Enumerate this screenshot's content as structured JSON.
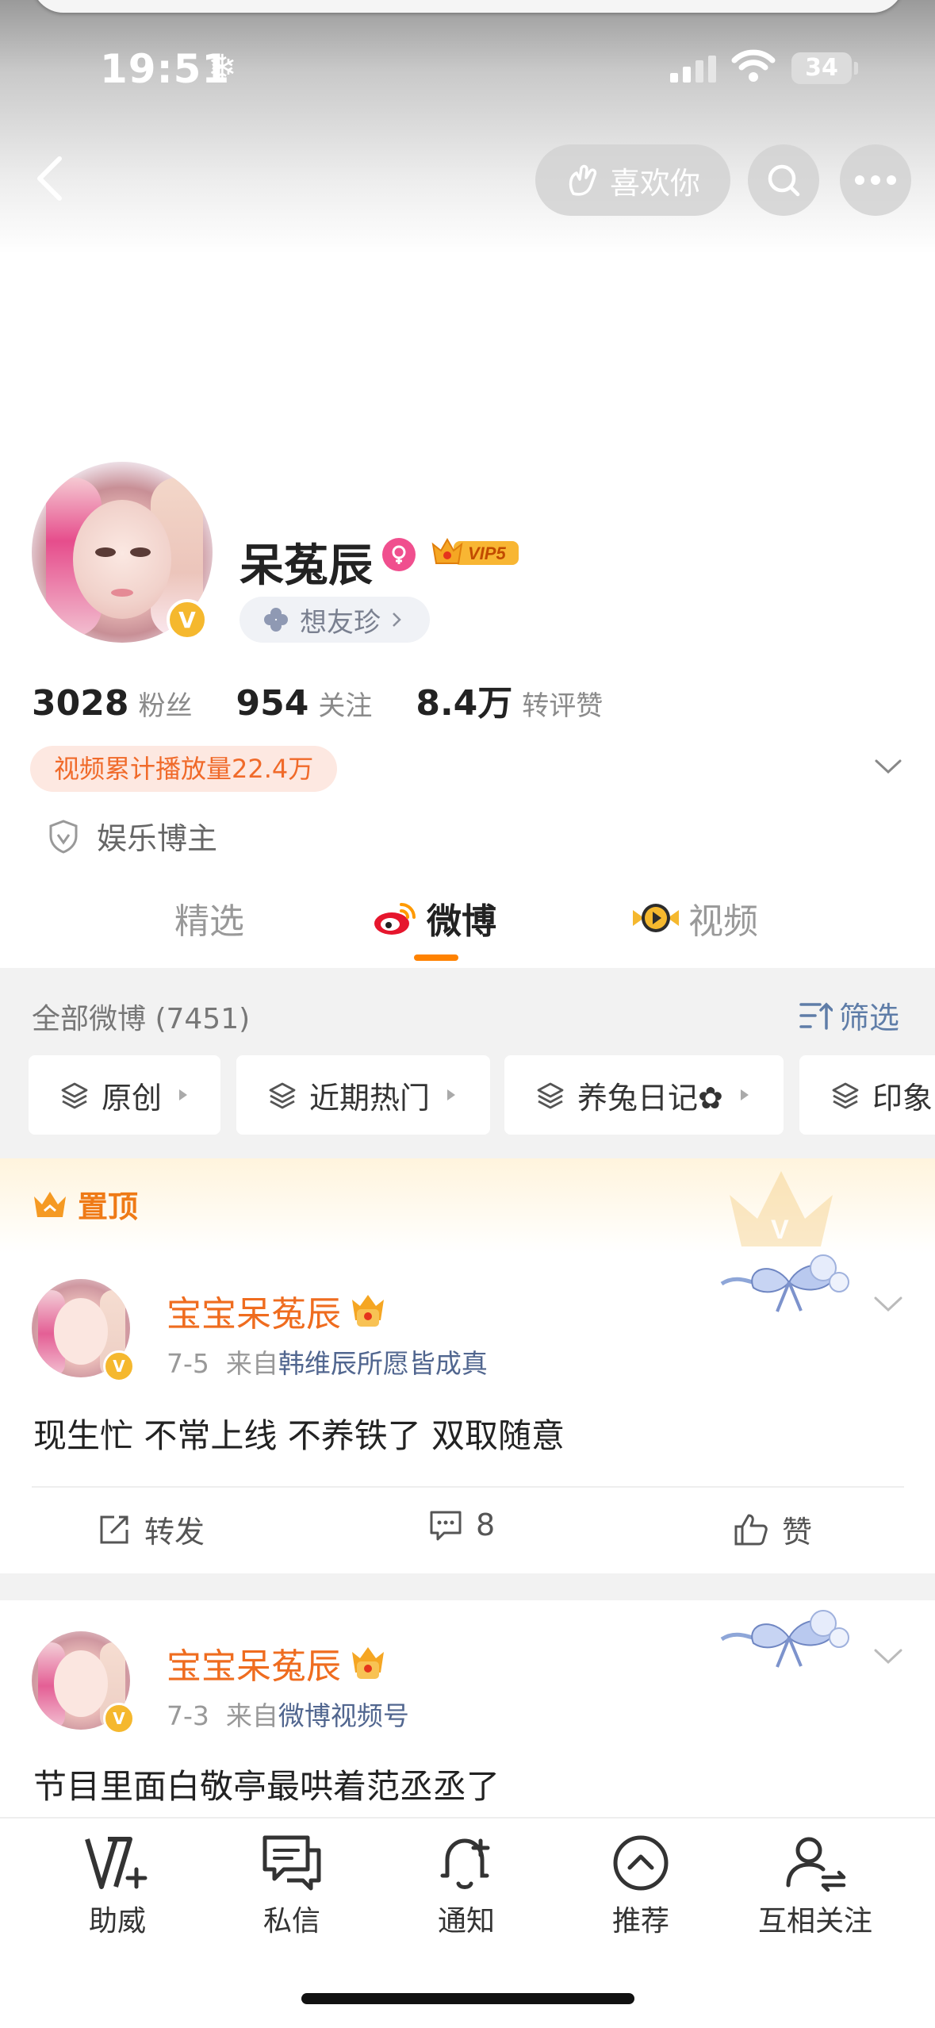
{
  "status_bar": {
    "time": "19:51",
    "weather_icon": "snowflake-icon",
    "battery": "34"
  },
  "nav": {
    "like_label": "喜欢你"
  },
  "profile": {
    "name": "呆菟辰",
    "vip_label": "VIP5",
    "tag": "想友珍",
    "stats": [
      {
        "value": "3028",
        "label": "粉丝"
      },
      {
        "value": "954",
        "label": "关注"
      },
      {
        "value": "8.4万",
        "label": "转评赞"
      }
    ],
    "video_plays": "视频累计播放量22.4万",
    "certification": "娱乐博主"
  },
  "tabs": [
    {
      "label": "精选",
      "active": false
    },
    {
      "label": "微博",
      "active": true
    },
    {
      "label": "视频",
      "active": false
    }
  ],
  "feed_header": {
    "all_label": "全部微博 (7451)",
    "filter_label": "筛选"
  },
  "chips": [
    "原创",
    "近期热门",
    "养兔日记✿",
    "印象"
  ],
  "pinned_label": "置顶",
  "posts": [
    {
      "author": "宝宝呆菟辰",
      "date": "7-5",
      "from_prefix": "来自",
      "source": "韩维辰所愿皆成真",
      "text": "现生忙 不常上线 不养铁了 双取随意",
      "actions": {
        "repost": "转发",
        "comments": "8",
        "like": "赞"
      }
    },
    {
      "author": "宝宝呆菟辰",
      "date": "7-3",
      "from_prefix": "来自",
      "source": "微博视频号",
      "text": "节目里面白敬亭最哄着范丞丞了"
    }
  ],
  "bottom_nav": [
    {
      "label": "助威",
      "icon": "cheer-v-icon"
    },
    {
      "label": "私信",
      "icon": "message-icon"
    },
    {
      "label": "通知",
      "icon": "bell-plus-icon"
    },
    {
      "label": "推荐",
      "icon": "chevron-up-circle-icon"
    },
    {
      "label": "互相关注",
      "icon": "mutual-follow-icon"
    }
  ],
  "colors": {
    "accent": "#ff8200",
    "name_orange": "#ef6c1f",
    "link_blue": "#51668f",
    "vip_gold": "#f5b82e"
  }
}
